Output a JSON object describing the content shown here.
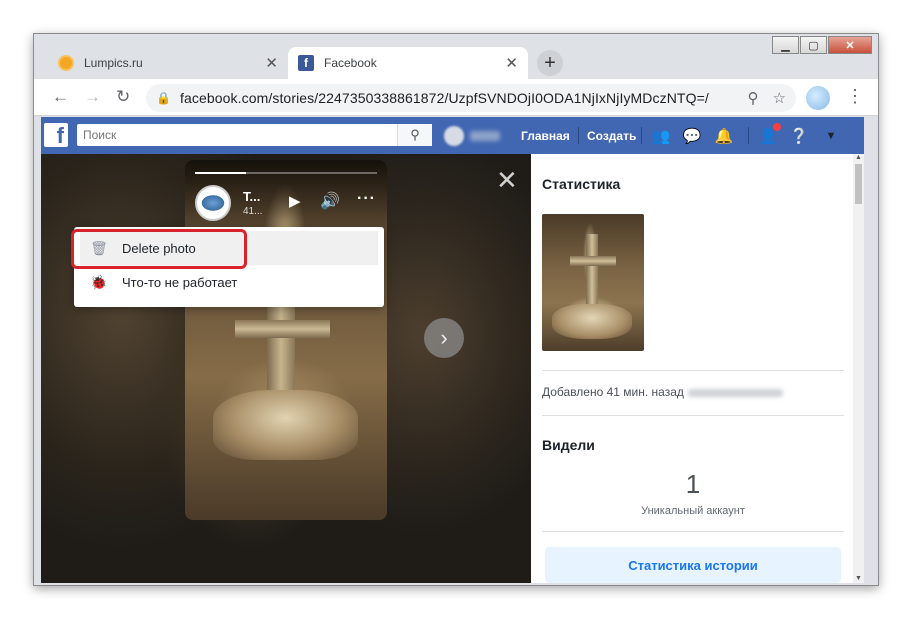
{
  "browser": {
    "tabs": [
      {
        "label": "Lumpics.ru",
        "active": false
      },
      {
        "label": "Facebook",
        "active": true
      }
    ],
    "url": "facebook.com/stories/2247350338861872/UzpfSVNDOjI0ODA1NjIxNjIyMDczNTQ=/",
    "new_tab_symbol": "+"
  },
  "facebook": {
    "search_placeholder": "Поиск",
    "nav": {
      "home": "Главная",
      "create": "Создать"
    }
  },
  "story": {
    "author_initial": "T...",
    "time": "41...",
    "progress": 0.28,
    "close_symbol": "✕"
  },
  "menu": {
    "items": [
      {
        "label": "Delete photo",
        "icon": "trash-icon"
      },
      {
        "label": "Что-то не работает",
        "icon": "bug-icon"
      }
    ]
  },
  "panel": {
    "stats_heading": "Статистика",
    "added": "Добавлено 41 мин. назад",
    "seen_heading": "Видели",
    "views_count": "1",
    "views_label": "Уникальный аккаунт",
    "stats_button": "Статистика истории"
  }
}
